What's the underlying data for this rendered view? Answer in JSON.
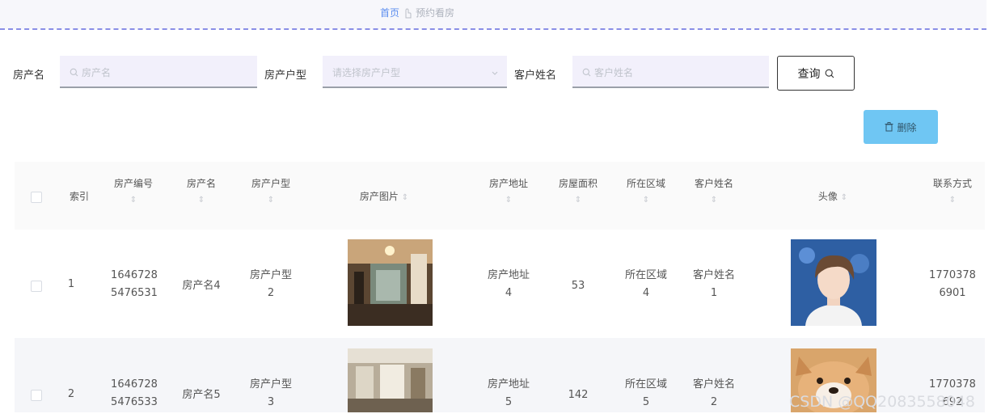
{
  "breadcrumb": {
    "home": "首页",
    "current": "预约看房"
  },
  "search": {
    "property_name_label": "房产名",
    "property_name_placeholder": "房产名",
    "property_type_label": "房产户型",
    "property_type_placeholder": "请选择房产户型",
    "customer_name_label": "客户姓名",
    "customer_name_placeholder": "客户姓名",
    "query_button": "查询"
  },
  "toolbar": {
    "delete_button": "删除"
  },
  "table": {
    "headers": [
      "索引",
      "房产编号",
      "房产名",
      "房产户型",
      "房产图片",
      "房产地址",
      "房屋面积",
      "所在区域",
      "客户姓名",
      "头像",
      "联系方式"
    ],
    "rows": [
      {
        "index": "1",
        "code": [
          "1646728",
          "5476531"
        ],
        "name": "房产名4",
        "type": [
          "房产户型",
          "2"
        ],
        "address": [
          "房产地址",
          "4"
        ],
        "area": "53",
        "region": [
          "所在区域",
          "4"
        ],
        "customer": [
          "客户姓名",
          "1"
        ],
        "phone": [
          "1770378",
          "6901"
        ]
      },
      {
        "index": "2",
        "code": [
          "1646728",
          "5476533"
        ],
        "name": "房产名5",
        "type": [
          "房产户型",
          "3"
        ],
        "address": [
          "房产地址",
          "5"
        ],
        "area": "142",
        "region": [
          "所在区域",
          "5"
        ],
        "customer": [
          "客户姓名",
          "2"
        ],
        "phone": [
          "1770378",
          "692"
        ]
      }
    ]
  },
  "watermark": "CSDN @QQ2083558048",
  "colors": {
    "accent": "#5b8def",
    "delete_button": "#6fc6f3",
    "dashed_line": "#8a8fe6",
    "input_bg": "#f2f0fb"
  }
}
